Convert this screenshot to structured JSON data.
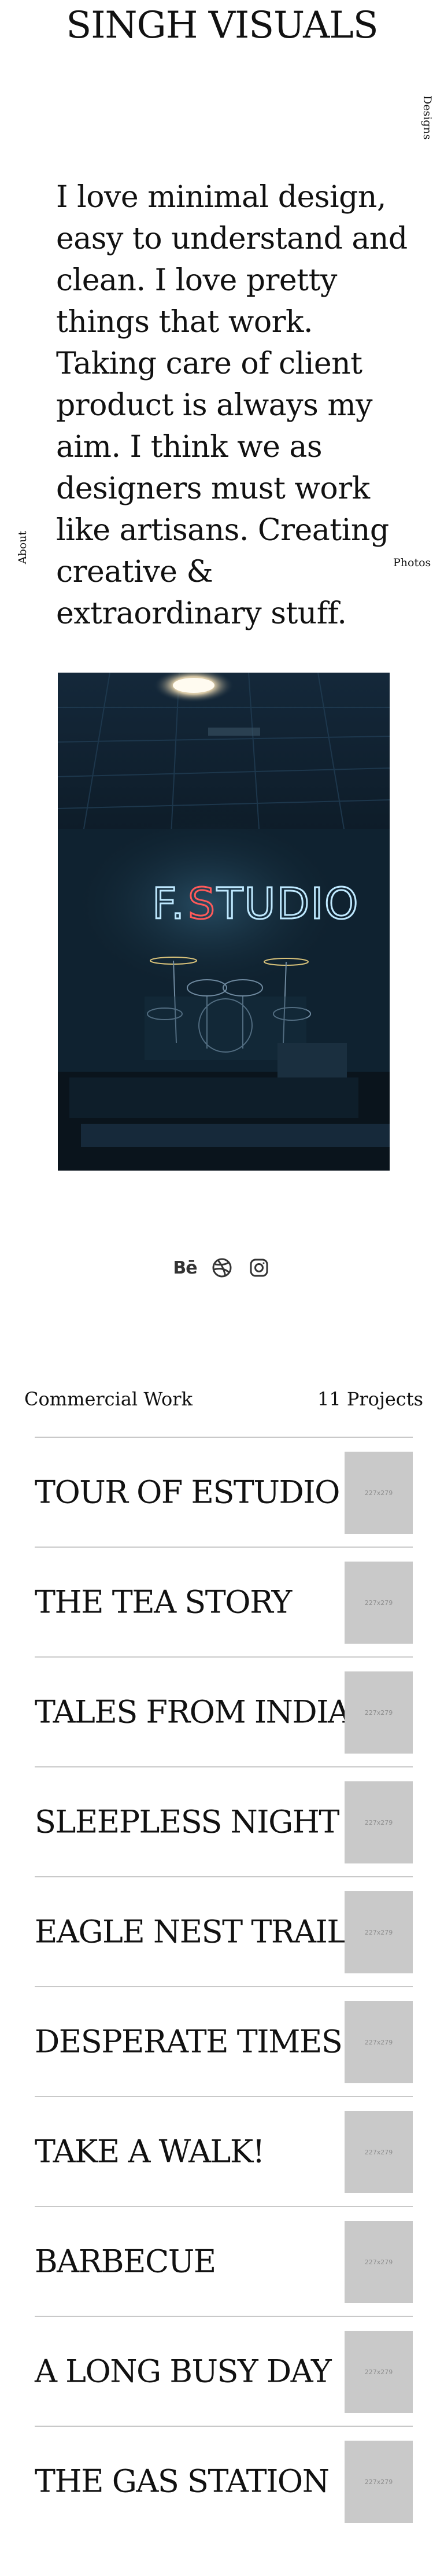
{
  "site": {
    "title": "SINGH VISUALS"
  },
  "nav": {
    "designs": "Designs",
    "about": "About",
    "photos": "Photos"
  },
  "intro": {
    "text": "I love minimal design, easy to understand and clean. I love pretty things that work. Taking care of client product is always my aim. I think we as designers must work like artisans. Creating creative & extraordinary stuff."
  },
  "hero": {
    "neon_text": "F.STUDIO"
  },
  "socials": [
    {
      "icon": "behance-icon",
      "glyph": "Bē"
    },
    {
      "icon": "dribbble-icon"
    },
    {
      "icon": "instagram-icon"
    }
  ],
  "work": {
    "heading": "Commercial Work",
    "count": "11 Projects",
    "projects": [
      {
        "name": "TOUR OF ESTUDIO",
        "thumb": "227x279"
      },
      {
        "name": "THE TEA STORY",
        "thumb": "227x279"
      },
      {
        "name": "TALES FROM INDIA",
        "thumb": "227x279"
      },
      {
        "name": "SLEEPLESS NIGHT",
        "thumb": "227x279"
      },
      {
        "name": "EAGLE NEST TRAILS",
        "thumb": "227x279"
      },
      {
        "name": "DESPERATE TIMES",
        "thumb": "227x279"
      },
      {
        "name": "TAKE A WALK!",
        "thumb": "227x279"
      },
      {
        "name": "BARBECUE",
        "thumb": "227x279"
      },
      {
        "name": "A LONG BUSY DAY",
        "thumb": "227x279"
      },
      {
        "name": "THE GAS STATION",
        "thumb": "227x279"
      }
    ]
  }
}
